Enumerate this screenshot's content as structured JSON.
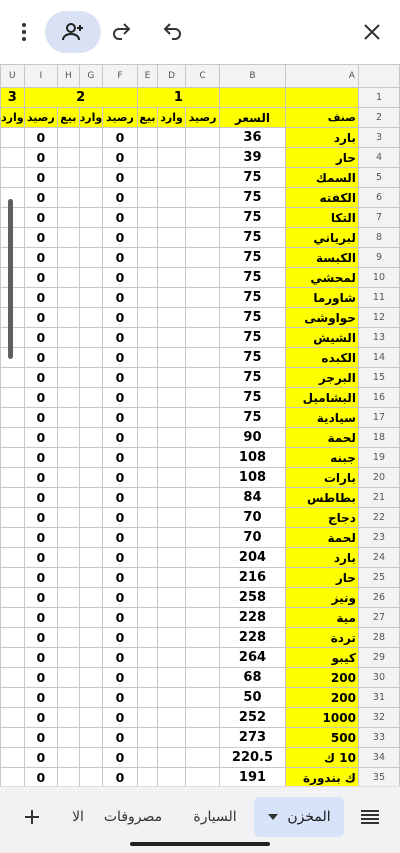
{
  "columns": [
    "U",
    "I",
    "H",
    "G",
    "F",
    "E",
    "D",
    "C",
    "B",
    "A"
  ],
  "group_headers": {
    "g3": "3",
    "g2": "2",
    "g1": "1"
  },
  "sub_headers": {
    "u": "وارد",
    "i": "رصيد",
    "h": "بيع",
    "g": "وارد",
    "f": "رصيد",
    "e": "بيع",
    "d": "وارد",
    "c": "رصيد",
    "b": "السعر",
    "a": "صنف"
  },
  "rows": [
    {
      "n": "3",
      "name": "بارد",
      "price": "36",
      "i": "0",
      "f": "0"
    },
    {
      "n": "4",
      "name": "حار",
      "price": "39",
      "i": "0",
      "f": "0"
    },
    {
      "n": "5",
      "name": "السمك",
      "price": "75",
      "i": "0",
      "f": "0"
    },
    {
      "n": "6",
      "name": "الكفته",
      "price": "75",
      "i": "0",
      "f": "0"
    },
    {
      "n": "7",
      "name": "التكا",
      "price": "75",
      "i": "0",
      "f": "0"
    },
    {
      "n": "8",
      "name": "لبرياني",
      "price": "75",
      "i": "0",
      "f": "0"
    },
    {
      "n": "9",
      "name": "الكبسة",
      "price": "75",
      "i": "0",
      "f": "0"
    },
    {
      "n": "10",
      "name": "لمحشي",
      "price": "75",
      "i": "0",
      "f": "0"
    },
    {
      "n": "11",
      "name": "شاورما",
      "price": "75",
      "i": "0",
      "f": "0"
    },
    {
      "n": "12",
      "name": "حواوشى",
      "price": "75",
      "i": "0",
      "f": "0"
    },
    {
      "n": "13",
      "name": "الشيش",
      "price": "75",
      "i": "0",
      "f": "0"
    },
    {
      "n": "14",
      "name": "الكبده",
      "price": "75",
      "i": "0",
      "f": "0"
    },
    {
      "n": "15",
      "name": "البرجر",
      "price": "75",
      "i": "0",
      "f": "0"
    },
    {
      "n": "16",
      "name": "البشاميل",
      "price": "75",
      "i": "0",
      "f": "0"
    },
    {
      "n": "17",
      "name": "سيادية",
      "price": "75",
      "i": "0",
      "f": "0"
    },
    {
      "n": "18",
      "name": "لحمة",
      "price": "90",
      "i": "0",
      "f": "0"
    },
    {
      "n": "19",
      "name": "جبنه",
      "price": "108",
      "i": "0",
      "f": "0"
    },
    {
      "n": "20",
      "name": "بارات",
      "price": "108",
      "i": "0",
      "f": "0"
    },
    {
      "n": "21",
      "name": "بطاطس",
      "price": "84",
      "i": "0",
      "f": "0"
    },
    {
      "n": "22",
      "name": "دجاج",
      "price": "70",
      "i": "0",
      "f": "0"
    },
    {
      "n": "23",
      "name": "لحمة",
      "price": "70",
      "i": "0",
      "f": "0"
    },
    {
      "n": "24",
      "name": "بارد",
      "price": "204",
      "i": "0",
      "f": "0"
    },
    {
      "n": "25",
      "name": "حار",
      "price": "216",
      "i": "0",
      "f": "0"
    },
    {
      "n": "26",
      "name": "ونيز",
      "price": "258",
      "i": "0",
      "f": "0"
    },
    {
      "n": "27",
      "name": "مية",
      "price": "228",
      "i": "0",
      "f": "0"
    },
    {
      "n": "28",
      "name": "تردة",
      "price": "228",
      "i": "0",
      "f": "0"
    },
    {
      "n": "29",
      "name": "كيبو",
      "price": "264",
      "i": "0",
      "f": "0"
    },
    {
      "n": "30",
      "name": "200",
      "price": "68",
      "i": "0",
      "f": "0"
    },
    {
      "n": "31",
      "name": "200",
      "price": "50",
      "i": "0",
      "f": "0"
    },
    {
      "n": "32",
      "name": "1000",
      "price": "252",
      "i": "0",
      "f": "0"
    },
    {
      "n": "33",
      "name": "500",
      "price": "273",
      "i": "0",
      "f": "0"
    },
    {
      "n": "34",
      "name": "10 ك",
      "price": "220.5",
      "i": "0",
      "f": "0"
    },
    {
      "n": "35",
      "name": "ك بندورة",
      "price": "191",
      "i": "0",
      "f": "0"
    }
  ],
  "tabs": {
    "warehouse": "المخزن",
    "car": "السيارة",
    "expenses": "مصروفات",
    "partial": "الا"
  },
  "icons": [
    "more-vert-icon",
    "add-person-icon",
    "redo-icon",
    "undo-icon",
    "close-icon",
    "add-icon",
    "chevron-down-icon",
    "sheet-list-icon"
  ]
}
